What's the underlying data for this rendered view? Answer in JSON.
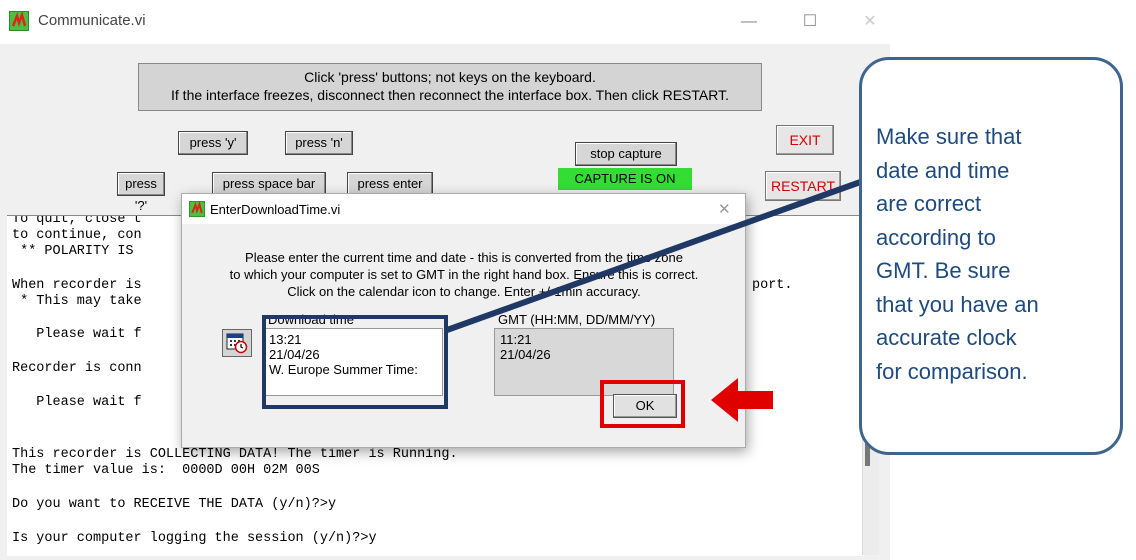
{
  "window": {
    "title": "Communicate.vi"
  },
  "banner": {
    "line1": "Click 'press' buttons; not keys on the keyboard.",
    "line2": "If the interface freezes, disconnect then reconnect the interface box. Then click RESTART."
  },
  "buttons": {
    "press_y": "press 'y'",
    "press_n": "press 'n'",
    "press_q": "press '?'",
    "press_space": "press space bar",
    "press_enter": "press enter",
    "stop_capture": "stop capture",
    "capture_status": "CAPTURE IS ON",
    "exit": "EXIT",
    "restart": "RESTART"
  },
  "console": {
    "lines": [
      "To quit, close t",
      "to continue, con",
      " ** POLARITY IS",
      "When recorder is",
      "port.",
      " * This may take",
      "   Please wait f",
      "Recorder is conn",
      "   Please wait f",
      "This recorder is COLLECTING DATA! The timer is Running.",
      "The timer value is:  0000D 00H 02M 00S",
      "Do you want to RECEIVE THE DATA (y/n)?>y",
      "Is your computer logging the session (y/n)?>y"
    ]
  },
  "dialog": {
    "title": "EnterDownloadTime.vi",
    "instructions": [
      "Please enter the current time and date - this is converted from the time zone",
      "to which your computer is set to GMT in the right hand box. Ensure this is correct.",
      "Click on the calendar icon to change. Enter +/-1min accuracy."
    ],
    "download_label": "Download time",
    "download_lines": [
      "13:21",
      "21/04/26",
      "W. Europe Summer Time:"
    ],
    "gmt_label": "GMT (HH:MM, DD/MM/YY)",
    "gmt_lines": [
      "11:21",
      "21/04/26"
    ],
    "ok": "OK"
  },
  "callout": {
    "lines": [
      "Make sure that",
      "date and time",
      "are correct",
      "according to",
      "GMT. Be sure",
      "that you have an",
      "accurate clock",
      "for comparison."
    ]
  },
  "colors": {
    "highlight_navy": "#1f3864",
    "highlight_red": "#e00000",
    "capture_green": "#33dd33",
    "callout_border": "#41648f"
  }
}
